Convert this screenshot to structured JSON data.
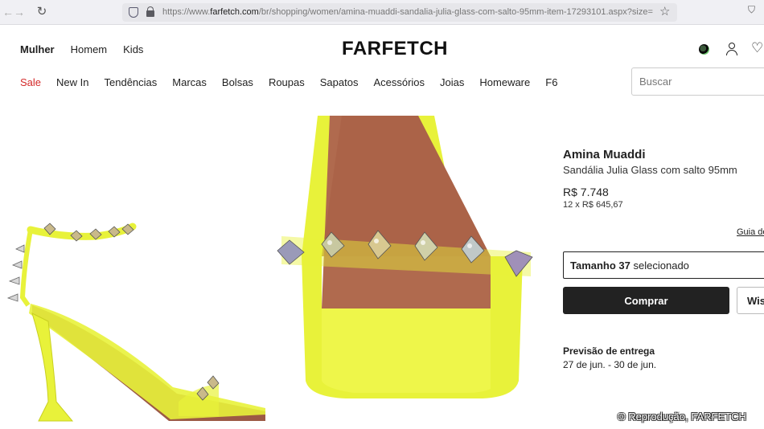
{
  "browser": {
    "url_prefix": "https://www.",
    "url_domain": "farfetch.com",
    "url_rest": "/br/shopping/women/amina-muaddi-sandalia-julia-glass-com-salto-95mm-item-17293101.aspx?size="
  },
  "header": {
    "gender_nav": [
      "Mulher",
      "Homem",
      "Kids"
    ],
    "logo": "FARFETCH",
    "categories": [
      "Sale",
      "New In",
      "Tendências",
      "Marcas",
      "Bolsas",
      "Roupas",
      "Sapatos",
      "Acessórios",
      "Joias",
      "Homeware",
      "F6"
    ],
    "search_placeholder": "Buscar"
  },
  "product": {
    "brand": "Amina Muaddi",
    "name": "Sandália Julia Glass com salto 95mm",
    "price": "R$ 7.748",
    "installments": "12 x R$ 645,67",
    "size_guide": "Guia de",
    "size_label": "Tamanho 37",
    "size_status": "selecionado",
    "buy_label": "Comprar",
    "wishlist_label": "Wis",
    "delivery_title": "Previsão de entrega",
    "delivery_dates": "27 de jun. - 30 de jun."
  },
  "credit": "© Reprodução, FARFETCH",
  "colors": {
    "neon_yellow": "#e8f23a",
    "sale_red": "#d42a2a",
    "button_dark": "#222222"
  }
}
